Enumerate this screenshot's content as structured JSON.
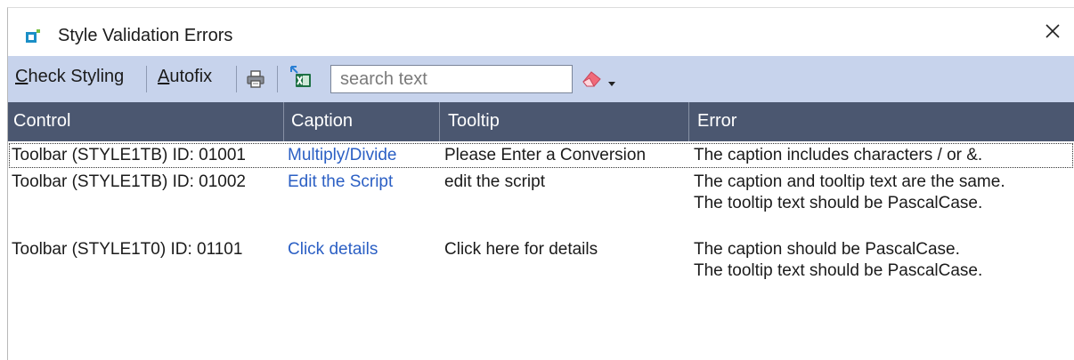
{
  "window": {
    "title": "Style Validation Errors"
  },
  "toolbar": {
    "check_styling": {
      "accel": "C",
      "rest": "heck Styling"
    },
    "autofix": {
      "accel": "A",
      "rest": "utofix"
    },
    "search_placeholder": "search text",
    "icons": [
      "printer-icon",
      "excel-export-icon",
      "eraser-icon",
      "dropdown-arrow-icon"
    ]
  },
  "table": {
    "columns": [
      "Control",
      "Caption",
      "Tooltip",
      "Error"
    ],
    "rows": [
      {
        "control": "Toolbar (STYLE1TB) ID: 01001",
        "caption": "Multiply/Divide",
        "tooltip": "Please Enter a Conversion",
        "errors": [
          "The caption includes characters / or &."
        ]
      },
      {
        "control": "Toolbar (STYLE1TB) ID: 01002",
        "caption": "Edit the Script",
        "tooltip": "edit the script",
        "errors": [
          "The caption and tooltip text are the same.",
          "The tooltip text should be PascalCase."
        ]
      },
      {
        "control": "Toolbar (STYLE1T0) ID: 01101",
        "caption": "Click details",
        "tooltip": "Click here for details",
        "errors": [
          "The caption should be PascalCase.",
          "The tooltip text should be PascalCase."
        ]
      }
    ]
  },
  "colors": {
    "toolbar_bg": "#c7d3ec",
    "header_bg": "#4b5770",
    "caption_link": "#2b5fc4"
  }
}
